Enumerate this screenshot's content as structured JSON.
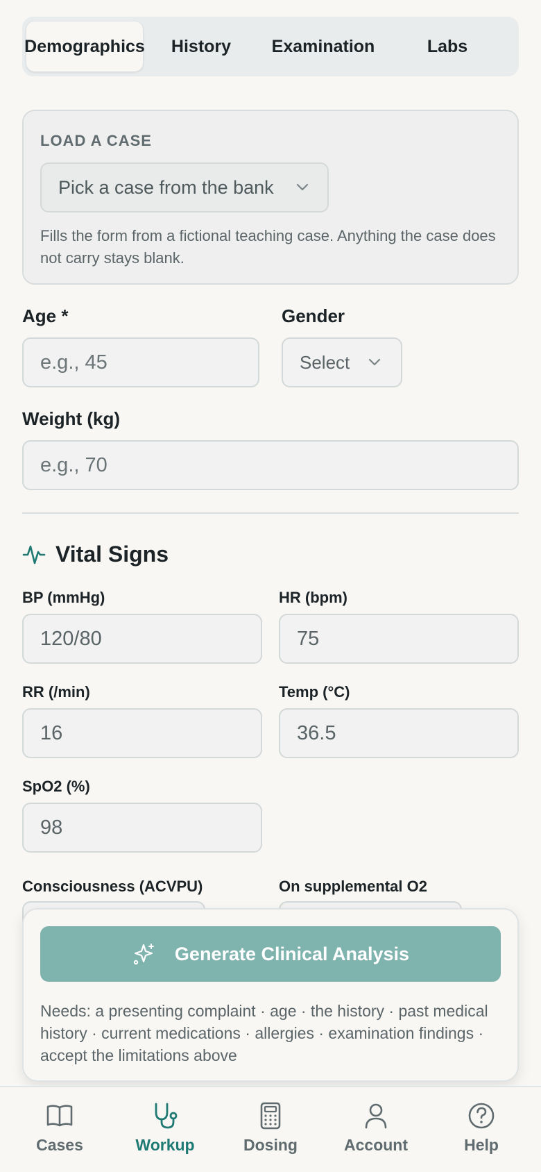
{
  "tabs": [
    {
      "label": "Demographics",
      "active": true
    },
    {
      "label": "History",
      "active": false
    },
    {
      "label": "Examination",
      "active": false
    },
    {
      "label": "Labs",
      "active": false
    }
  ],
  "load_case": {
    "title": "LOAD A CASE",
    "select_placeholder": "Pick a case from the bank",
    "help": "Fills the form from a fictional teaching case. Anything the case does not carry stays blank."
  },
  "demographics": {
    "age_label": "Age *",
    "age_placeholder": "e.g., 45",
    "gender_label": "Gender",
    "gender_value": "Select",
    "weight_label": "Weight (kg)",
    "weight_placeholder": "e.g., 70"
  },
  "vitals": {
    "title": "Vital Signs",
    "bp_label": "BP (mmHg)",
    "bp_value": "120/80",
    "hr_label": "HR (bpm)",
    "hr_value": "75",
    "rr_label": "RR (/min)",
    "rr_value": "16",
    "temp_label": "Temp (°C)",
    "temp_value": "36.5",
    "spo2_label": "SpO2 (%)",
    "spo2_value": "98",
    "consciousness_label": "Consciousness (ACVPU)",
    "o2_label": "On supplemental O2"
  },
  "action": {
    "button_label": "Generate Clinical Analysis",
    "needs_text": "Needs: a presenting complaint · age · the history · past medical history · current medications · allergies · examination findings · accept the limitations above"
  },
  "nav": [
    {
      "label": "Cases",
      "icon": "book-icon",
      "active": false
    },
    {
      "label": "Workup",
      "icon": "stethoscope-icon",
      "active": true
    },
    {
      "label": "Dosing",
      "icon": "calculator-icon",
      "active": false
    },
    {
      "label": "Account",
      "icon": "user-icon",
      "active": false
    },
    {
      "label": "Help",
      "icon": "help-circle-icon",
      "active": false
    }
  ],
  "colors": {
    "accent": "#1e7a73",
    "button": "#7fb3ae",
    "background": "#f8f7f4"
  }
}
